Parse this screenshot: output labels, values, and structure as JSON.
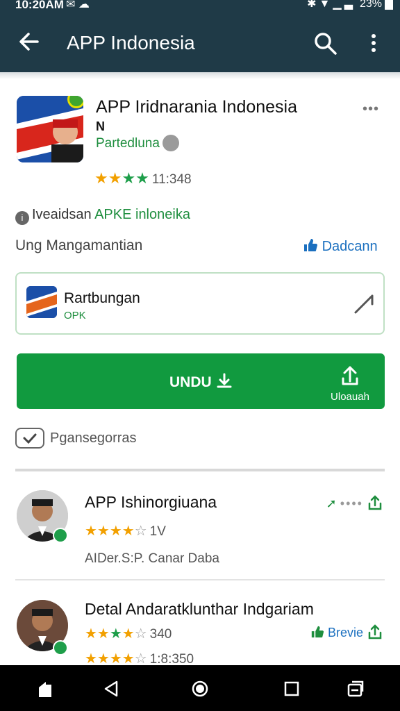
{
  "status_bar": {
    "time": "10:20AM",
    "icons": "✉ ☁",
    "system_icons": "✱▼▁▃",
    "battery": "23%"
  },
  "app_bar": {
    "title": "APP Indonesia"
  },
  "app_header": {
    "name": "APP Iridnarania Indonesia",
    "subtitle": "N",
    "developer": "Partedluna",
    "rating_count": "11:348",
    "kebab": "•••"
  },
  "info": {
    "line_prefix": "Iveaidsan ",
    "line_highlight": "APKE inloneika",
    "subline": "Ung Mangamantian",
    "download_link": "Dadcann"
  },
  "card": {
    "title": "Rartbungan",
    "subtitle": "OPK"
  },
  "install": {
    "label": "UNDU",
    "share_label": "Uloauah"
  },
  "safety": {
    "text": "Pgansegorras"
  },
  "list": [
    {
      "title": "APP Ishinorgiuana",
      "stars_filled": "★★★★",
      "stars_empty": "☆",
      "count": "1V",
      "meta": "AIDer.S:P. Canar Daba",
      "action": ""
    },
    {
      "title": "Detal Andaratklunthar Indgariam",
      "stars_filled": "★★★★",
      "stars_empty": "☆",
      "count": "340",
      "count2": "1:8:350",
      "action": "Brevie"
    }
  ],
  "colors": {
    "app_bar": "#1f3a47",
    "primary_green": "#119a3f",
    "link_blue": "#1a6fbf",
    "star_yellow": "#f2a000"
  }
}
